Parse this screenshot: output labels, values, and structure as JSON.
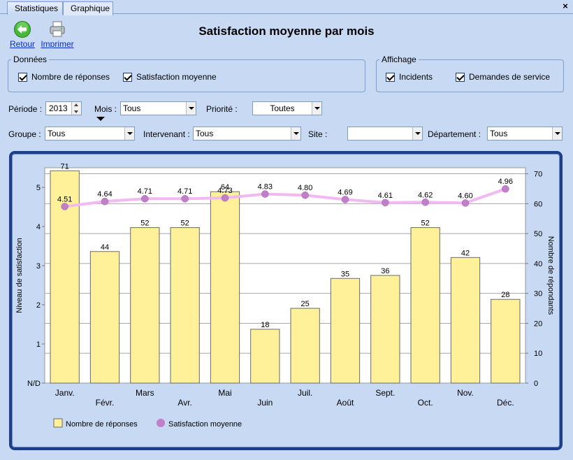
{
  "tabs": [
    {
      "label": "Statistiques",
      "active": false
    },
    {
      "label": "Graphique",
      "active": true
    }
  ],
  "close_glyph": "×",
  "toolbar": {
    "back_label": "Retour",
    "back_icon": "back-arrow-icon",
    "print_label": "Imprimer",
    "print_icon": "printer-icon"
  },
  "title": "Satisfaction moyenne par mois",
  "donnees": {
    "legend": "Données",
    "options": [
      {
        "label": "Nombre de réponses",
        "checked": true
      },
      {
        "label": "Satisfaction moyenne",
        "checked": true
      }
    ]
  },
  "affichage": {
    "legend": "Affichage",
    "options": [
      {
        "label": "Incidents",
        "checked": true
      },
      {
        "label": "Demandes de service",
        "checked": true
      }
    ]
  },
  "filters": {
    "periode_label": "Période :",
    "periode_value": "2013",
    "mois_label": "Mois :",
    "mois_value": "Tous",
    "priorite_label": "Priorité :",
    "priorite_value": "Toutes",
    "groupe_label": "Groupe :",
    "groupe_value": "Tous",
    "intervenant_label": "Intervenant :",
    "intervenant_value": "Tous",
    "site_label": "Site :",
    "site_value": "",
    "departement_label": "Département :",
    "departement_value": "Tous"
  },
  "colors": {
    "bar_fill": "#fff09a",
    "bar_stroke": "#6a6a6a",
    "line": "#f2b8f2",
    "marker": "#c07fc8",
    "frame": "#1d3f8a"
  },
  "chart_data": {
    "type": "bar",
    "categories": [
      "Janv.",
      "Févr.",
      "Mars",
      "Avr.",
      "Mai",
      "Juin",
      "Juil.",
      "Août",
      "Sept.",
      "Oct.",
      "Nov.",
      "Déc."
    ],
    "series": [
      {
        "name": "Nombre de réponses",
        "type": "bar",
        "axis": "right",
        "values": [
          71,
          44,
          52,
          52,
          64,
          18,
          25,
          35,
          36,
          52,
          42,
          28
        ]
      },
      {
        "name": "Satisfaction moyenne",
        "type": "line",
        "axis": "left",
        "values": [
          4.51,
          4.64,
          4.71,
          4.71,
          4.73,
          4.83,
          4.8,
          4.69,
          4.61,
          4.62,
          4.6,
          4.96
        ],
        "labels": [
          "4.51",
          "4.64",
          "4.71",
          "4.71",
          "4.73",
          "4.83",
          "4.80",
          "4.69",
          "4.61",
          "4.62",
          "4.60",
          "4.96"
        ]
      }
    ],
    "ylabel_left": "Niveau de satisfaction",
    "ylabel_right": "Nombre de répondants",
    "yticks_left": [
      "N/D",
      "1",
      "2",
      "3",
      "4",
      "5"
    ],
    "ylim_left": [
      0,
      5.5
    ],
    "yticks_right": [
      "0",
      "10",
      "20",
      "30",
      "40",
      "50",
      "60",
      "70"
    ],
    "ylim_right": [
      0,
      72
    ],
    "grid": true,
    "legend_position": "bottom-left"
  }
}
